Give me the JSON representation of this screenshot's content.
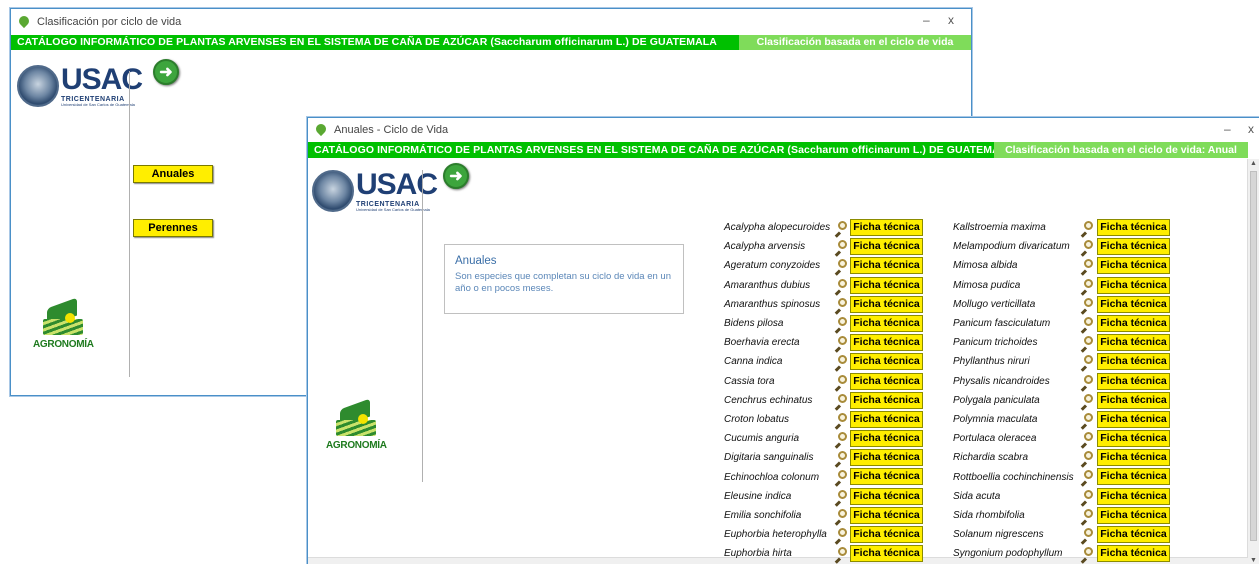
{
  "win1": {
    "title": "Clasificación por ciclo de vida",
    "min": "–",
    "close": "x",
    "header": "CATÁLOGO INFORMÁTICO DE PLANTAS ARVENSES EN EL SISTEMA DE CAÑA DE AZÚCAR (Saccharum officinarum L.) DE GUATEMALA",
    "header_right": "Clasificación basada en el ciclo de vida",
    "usac": "USAC",
    "usac_sub": "TRICENTENARIA",
    "usac_sub2": "Universidad de San Carlos de Guatemala",
    "agro": "AGRONOMÍA",
    "btn_anuales": "Anuales",
    "btn_perennes": "Perennes"
  },
  "win2": {
    "title": "Anuales - Ciclo de Vida",
    "min": "–",
    "close": "x",
    "header": "CATÁLOGO INFORMÁTICO DE PLANTAS ARVENSES EN EL SISTEMA DE CAÑA DE AZÚCAR (Saccharum officinarum L.) DE GUATEMALA",
    "header_right": "Clasificación basada en el ciclo de vida: Anual",
    "usac": "USAC",
    "usac_sub": "TRICENTENARIA",
    "usac_sub2": "Universidad de San Carlos de Guatemala",
    "agro": "AGRONOMÍA",
    "info_title": "Anuales",
    "info_body": "Son especies que completan su ciclo de vida en un año o en pocos meses.",
    "button_label": "Ficha técnica",
    "species_left": [
      "Acalypha alopecuroides",
      "Acalypha arvensis",
      "Ageratum conyzoides",
      "Amaranthus dubius",
      "Amaranthus spinosus",
      "Bidens pilosa",
      "Boerhavia erecta",
      "Canna indica",
      "Cassia tora",
      "Cenchrus echinatus",
      "Croton lobatus",
      "Cucumis anguria",
      "Digitaria sanguinalis",
      "Echinochloa colonum",
      "Eleusine indica",
      "Emilia sonchifolia",
      "Euphorbia heterophylla",
      "Euphorbia hirta"
    ],
    "species_right": [
      "Kallstroemia maxima",
      "Melampodium divaricatum",
      "Mimosa albida",
      "Mimosa pudica",
      "Mollugo verticillata",
      "Panicum fasciculatum",
      "Panicum trichoides",
      "Phyllanthus niruri",
      "Physalis nicandroides",
      "Polygala paniculata",
      "Polymnia maculata",
      "Portulaca oleracea",
      "Richardia scabra",
      "Rottboellia cochinchinensis",
      "Sida acuta",
      "Sida rhombifolia",
      "Solanum nigrescens",
      "Syngonium podophyllum"
    ]
  },
  "colors": {
    "header_green": "#00c000",
    "header_right_green": "#7fdc5a",
    "button_yellow": "#ffee00",
    "usac_blue": "#1f3f74",
    "agro_green": "#1e7a1e"
  }
}
